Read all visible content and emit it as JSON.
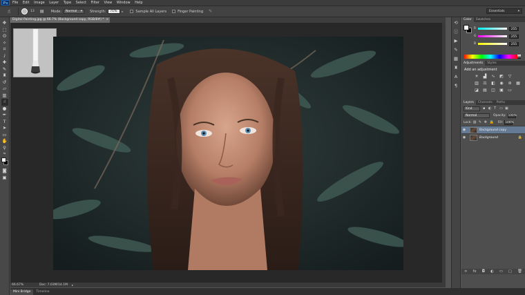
{
  "app": {
    "logo": "Ps"
  },
  "menu": [
    "File",
    "Edit",
    "Image",
    "Layer",
    "Type",
    "Select",
    "Filter",
    "View",
    "Window",
    "Help"
  ],
  "options_bar": {
    "brush_size": "13",
    "mode_label": "Mode:",
    "mode_value": "Normal",
    "strength_label": "Strength:",
    "strength_value": "71%",
    "sample_all_layers": "Sample All Layers",
    "finger_painting": "Finger Painting",
    "workspace": "Essentials"
  },
  "document": {
    "tab_title": "Digital Painting.jpg @ 66.7% (Background copy, RGB/8#) *",
    "tab_close": "×",
    "zoom": "66.67%",
    "doc_size": "Doc: 7.03M/14.1M"
  },
  "bottom_tabs": [
    "Mini Bridge",
    "Timeline"
  ],
  "color_panel": {
    "tabs": [
      "Color",
      "Swatches"
    ],
    "sliders": [
      {
        "label": "R",
        "value": "255"
      },
      {
        "label": "G",
        "value": "255"
      },
      {
        "label": "B",
        "value": "255"
      }
    ]
  },
  "adjustments_panel": {
    "tabs": [
      "Adjustments",
      "Styles"
    ],
    "title": "Add an adjustment"
  },
  "layers_panel": {
    "tabs": [
      "Layers",
      "Channels",
      "Paths"
    ],
    "filter_kind": "Kind",
    "blend_mode": "Normal",
    "opacity_label": "Opacity:",
    "opacity_value": "100%",
    "lock_label": "Lock:",
    "fill_label": "Fill:",
    "fill_value": "100%",
    "layers": [
      {
        "name": "Background copy",
        "selected": true
      },
      {
        "name": "Background",
        "selected": false
      }
    ]
  },
  "colors": {
    "accent_selected_layer": "#657a95",
    "foreground": "#ffffff",
    "background": "#000000"
  }
}
